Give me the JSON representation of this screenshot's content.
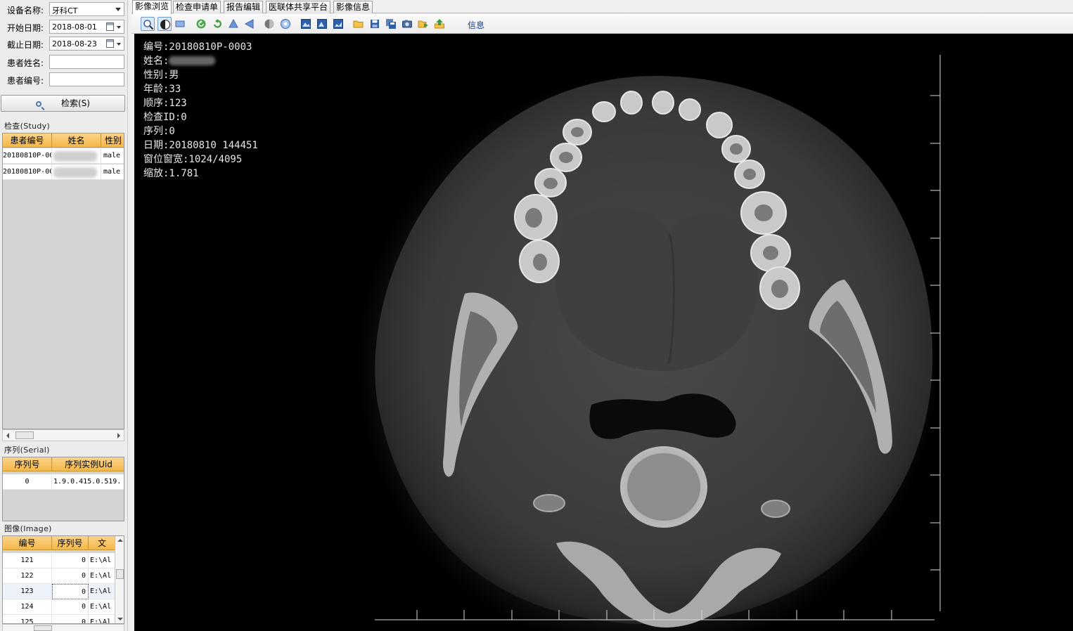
{
  "filters": {
    "device_label": "设备名称:",
    "device_value": "牙科CT",
    "start_label": "开始日期:",
    "start_value": "2018-08-01",
    "end_label": "截止日期:",
    "end_value": "2018-08-23",
    "patient_name_label": "患者姓名:",
    "patient_name_value": "",
    "patient_id_label": "患者编号:",
    "patient_id_value": "",
    "search_label": "检索(S)"
  },
  "study": {
    "title": "检查(Study)",
    "columns": [
      "患者编号",
      "姓名",
      "性别"
    ],
    "rows": [
      {
        "id": "20180810P-000",
        "name": "",
        "sex": "male"
      },
      {
        "id": "20180810P-000",
        "name": "",
        "sex": "male"
      }
    ]
  },
  "serial": {
    "title": "序列(Serial)",
    "columns": [
      "序列号",
      "序列实例Uid"
    ],
    "rows": [
      {
        "no": "0",
        "uid": "1.9.0.415.0.519."
      }
    ]
  },
  "image": {
    "title": "图像(Image)",
    "columns": [
      "编号",
      "序列号",
      "文"
    ],
    "rows": [
      {
        "no": "121",
        "serial": "0",
        "path": "E:\\Al"
      },
      {
        "no": "122",
        "serial": "0",
        "path": "E:\\Al"
      },
      {
        "no": "123",
        "serial": "0",
        "path": "E:\\Al"
      },
      {
        "no": "124",
        "serial": "0",
        "path": "E:\\Al"
      },
      {
        "no": "125",
        "serial": "0",
        "path": "E:\\Al"
      }
    ]
  },
  "tabs": [
    "影像浏览",
    "检查申请单",
    "报告编辑",
    "医联体共享平台",
    "影像信息"
  ],
  "toolbar": {
    "icons": [
      "zoom-icon",
      "window-level-icon",
      "select-rect-icon",
      "rotate-left-icon",
      "rotate-right-icon",
      "flip-vertical-icon",
      "flip-horizontal-icon",
      "invert-icon",
      "reset-icon",
      "image-single-icon",
      "image-compare-icon",
      "image-series-icon",
      "open-folder-icon",
      "save-icon",
      "save-all-icon",
      "camera-icon",
      "export-icon",
      "upload-icon"
    ],
    "info_label": "信息"
  },
  "overlay": {
    "number": "编号:20180810P-0003",
    "name_prefix": "姓名:",
    "sex": "性别:男",
    "age": "年龄:33",
    "order": "顺序:123",
    "check_id": "检查ID:0",
    "series": "序列:0",
    "date": "日期:20180810 144451",
    "window": "窗位窗宽:1024/4095",
    "zoom": "缩放:1.781"
  },
  "colors": {
    "grid_header": "#f5b748",
    "viewer_background": "#000000",
    "overlay_text": "#e8e8e8"
  }
}
